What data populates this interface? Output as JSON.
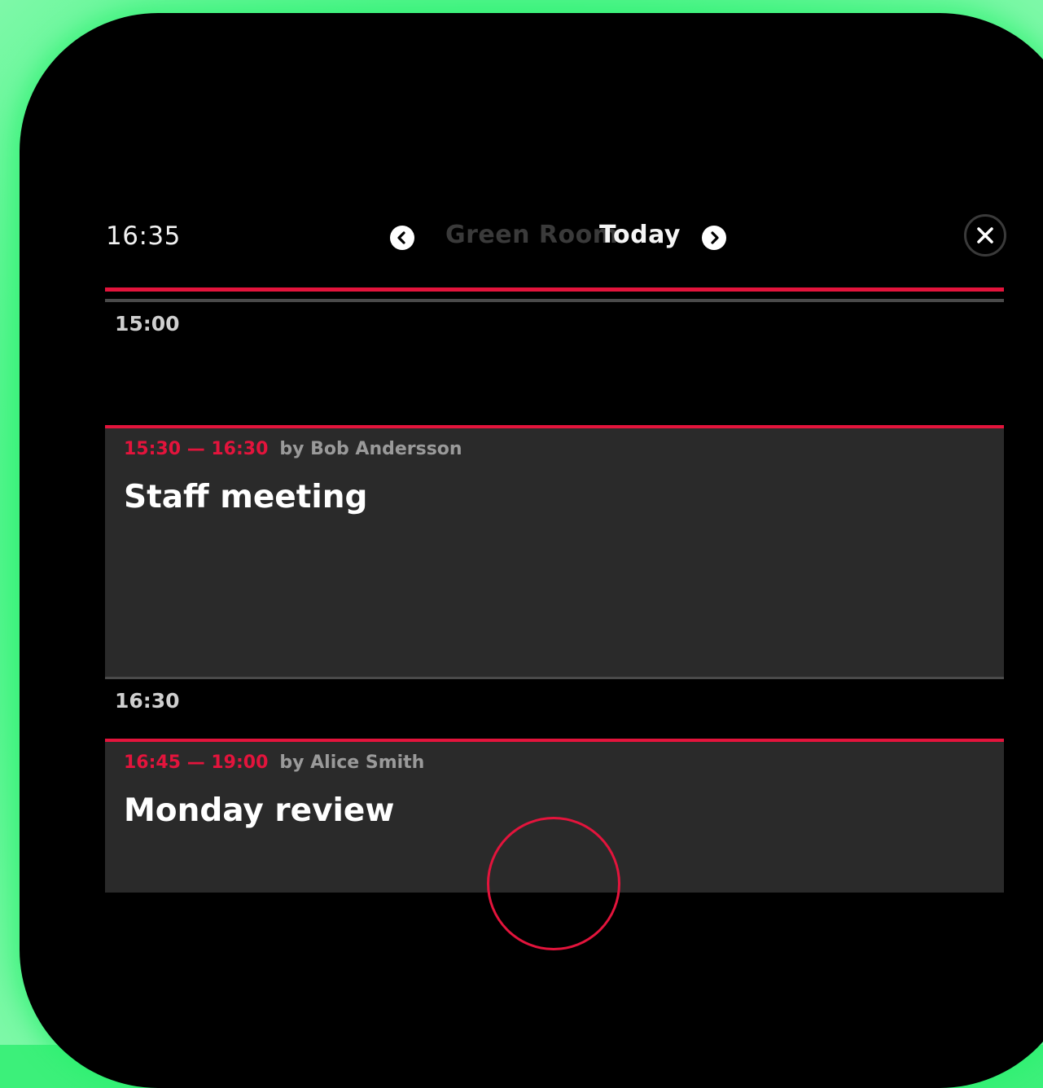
{
  "header": {
    "clock": "16:35",
    "room_name": "Green Room",
    "day_label": "Today",
    "prev_icon": "chevron-left-icon",
    "next_icon": "chevron-right-icon",
    "close_icon": "close-icon"
  },
  "timeline": {
    "hour_labels": [
      "15:00",
      "16:30"
    ],
    "events": [
      {
        "time": "15:30 — 16:30",
        "host": "by Bob Andersson",
        "title": "Staff meeting"
      },
      {
        "time": "16:45 — 19:00",
        "host": "by Alice Smith",
        "title": "Monday review"
      }
    ]
  },
  "colors": {
    "accent": "#e3143c",
    "background": "#000000",
    "event_background": "#2a2a2a",
    "bezel_glow": "#3cf07a"
  }
}
